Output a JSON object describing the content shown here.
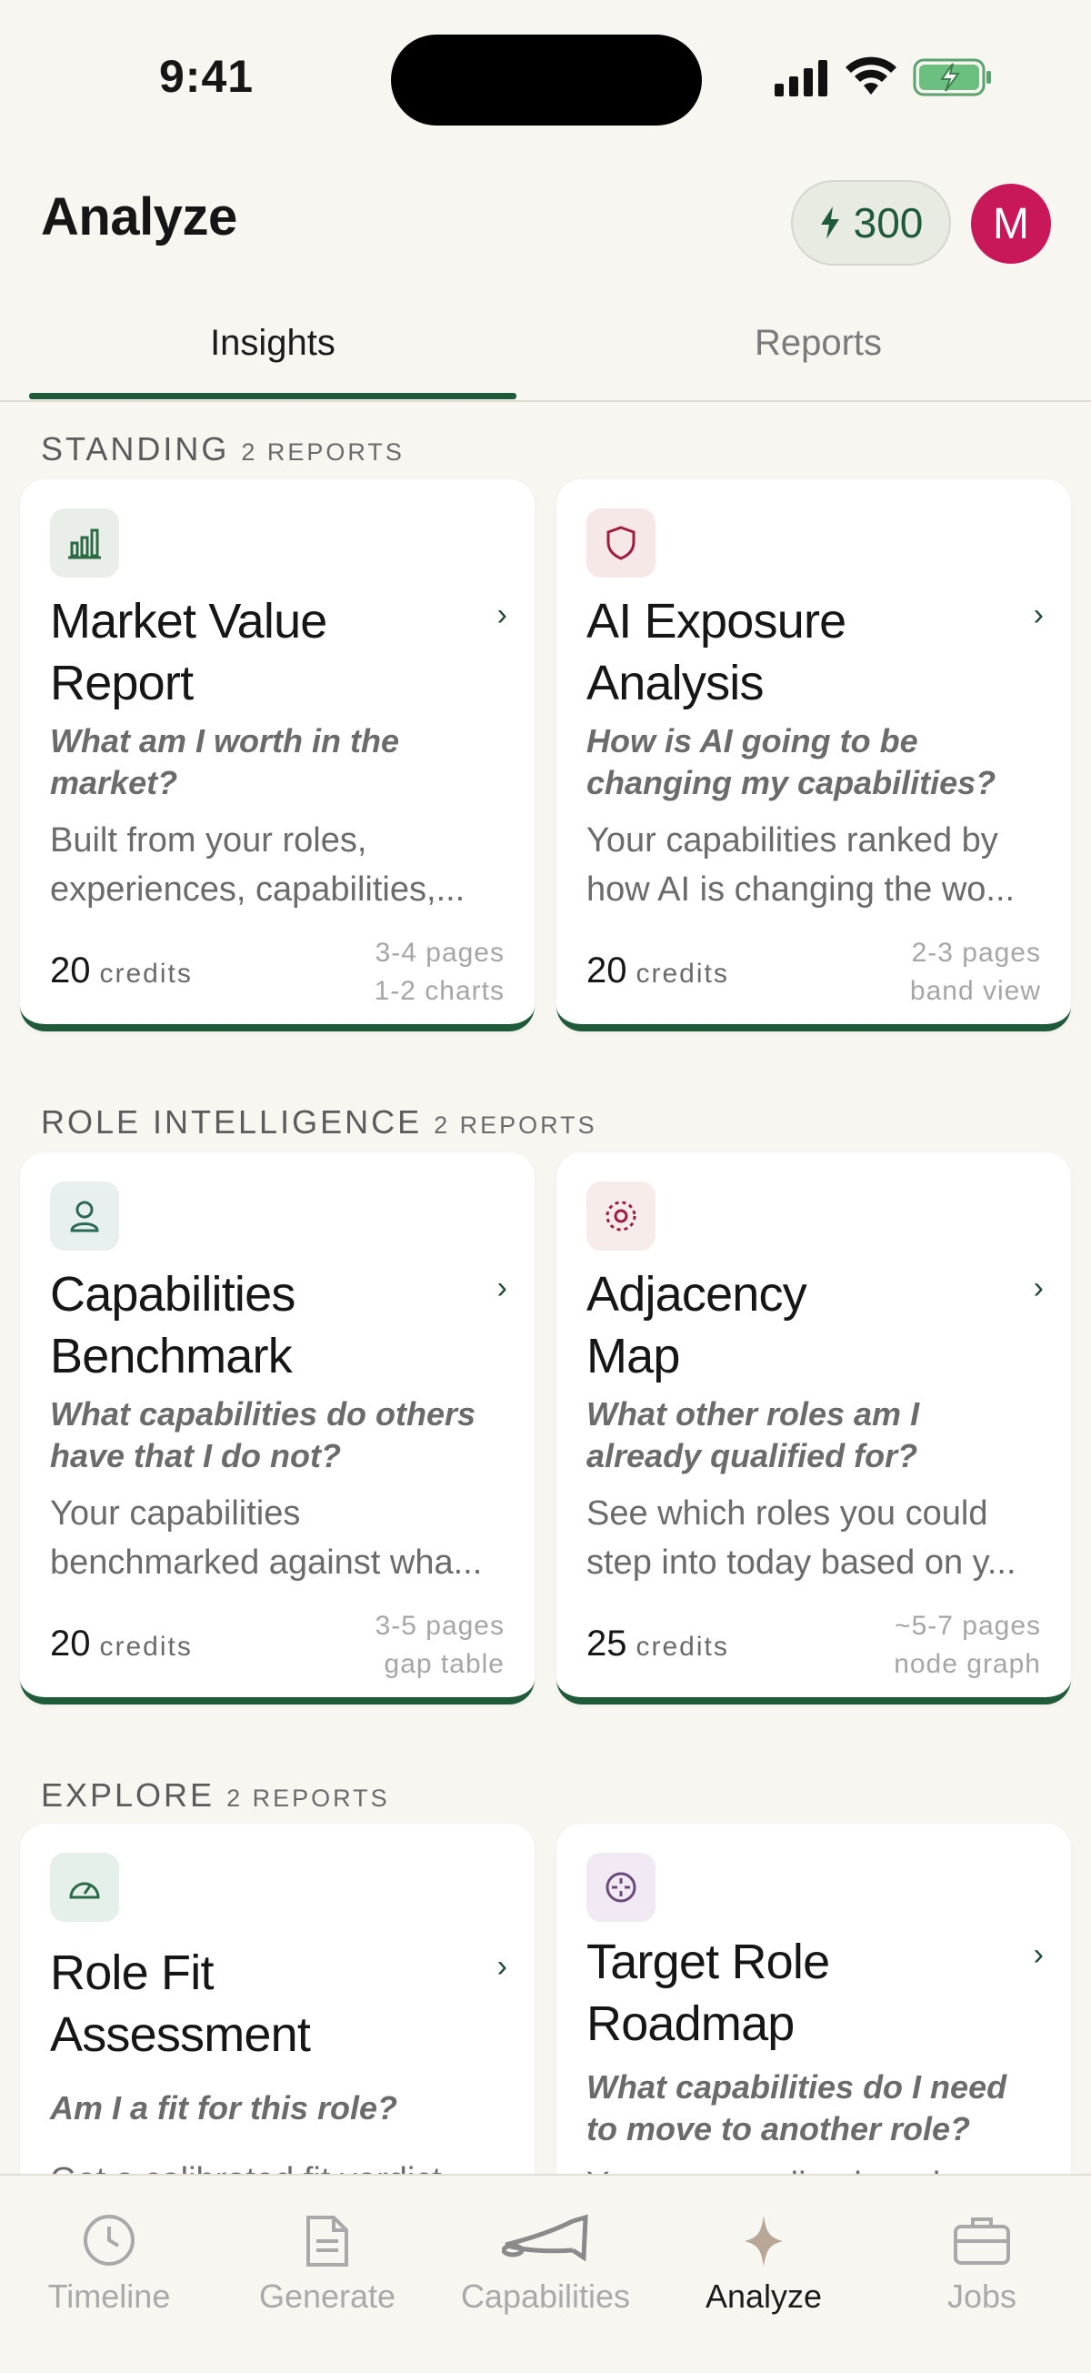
{
  "status_bar": {
    "time": "9:41"
  },
  "header": {
    "title": "Analyze",
    "credits": "300",
    "avatar_initial": "M"
  },
  "tabs": [
    {
      "label": "Insights",
      "active": true
    },
    {
      "label": "Reports",
      "active": false
    }
  ],
  "sections": [
    {
      "label": "STANDING",
      "count": "2 REPORTS",
      "cards": [
        {
          "icon": "bar-chart-icon",
          "title_lines": [
            "Market Value",
            "Report"
          ],
          "question": "What am I worth in the market?",
          "description_lines": [
            "Built from your roles,",
            "experiences, capabilities,..."
          ],
          "credits": "20",
          "credits_label": "credits",
          "meta": [
            "3-4 pages",
            "1-2 charts"
          ]
        },
        {
          "icon": "shield-icon",
          "title_lines": [
            "AI Exposure",
            "Analysis"
          ],
          "question": "How is AI going to be changing my capabilities?",
          "description_lines": [
            "Your capabilities ranked by",
            "how AI is changing the wo..."
          ],
          "credits": "20",
          "credits_label": "credits",
          "meta": [
            "2-3 pages",
            "band view"
          ]
        }
      ]
    },
    {
      "label": "ROLE INTELLIGENCE",
      "count": "2 REPORTS",
      "cards": [
        {
          "icon": "person-icon",
          "title_lines": [
            "Capabilities",
            "Benchmark"
          ],
          "question": "What capabilities do others have that I do not?",
          "description_lines": [
            "Your capabilities",
            "benchmarked against wha..."
          ],
          "credits": "20",
          "credits_label": "credits",
          "meta": [
            "3-5 pages",
            "gap table"
          ]
        },
        {
          "icon": "target-dots-icon",
          "title_lines": [
            "Adjacency",
            "Map"
          ],
          "question": "What other roles am I already qualified for?",
          "description_lines": [
            "See which roles you could",
            "step into today based on y..."
          ],
          "credits": "25",
          "credits_label": "credits",
          "meta": [
            "~5-7 pages",
            "node graph"
          ]
        }
      ]
    },
    {
      "label": "EXPLORE",
      "count": "2 REPORTS",
      "cards": [
        {
          "icon": "gauge-icon",
          "title_lines": [
            "Role Fit",
            "Assessment"
          ],
          "question": "Am I a fit for this role?",
          "description_lines": [
            "Get a calibrated fit verdict"
          ]
        },
        {
          "icon": "crosshair-icon",
          "title_lines": [
            "Target Role",
            "Roadmap"
          ],
          "question": "What capabilities do I need to move to another role?",
          "description_lines": [
            "Your personalized roadmap"
          ]
        }
      ]
    }
  ],
  "bottom_nav": [
    {
      "label": "Timeline",
      "icon": "clock-icon"
    },
    {
      "label": "Generate",
      "icon": "document-icon"
    },
    {
      "label": "Capabilities",
      "icon": "horn-icon"
    },
    {
      "label": "Analyze",
      "icon": "sparkle-icon",
      "active": true
    },
    {
      "label": "Jobs",
      "icon": "briefcase-icon"
    }
  ],
  "colors": {
    "accent": "#1f5a3a",
    "avatar": "#c8185a",
    "background": "#f8f6f1"
  }
}
